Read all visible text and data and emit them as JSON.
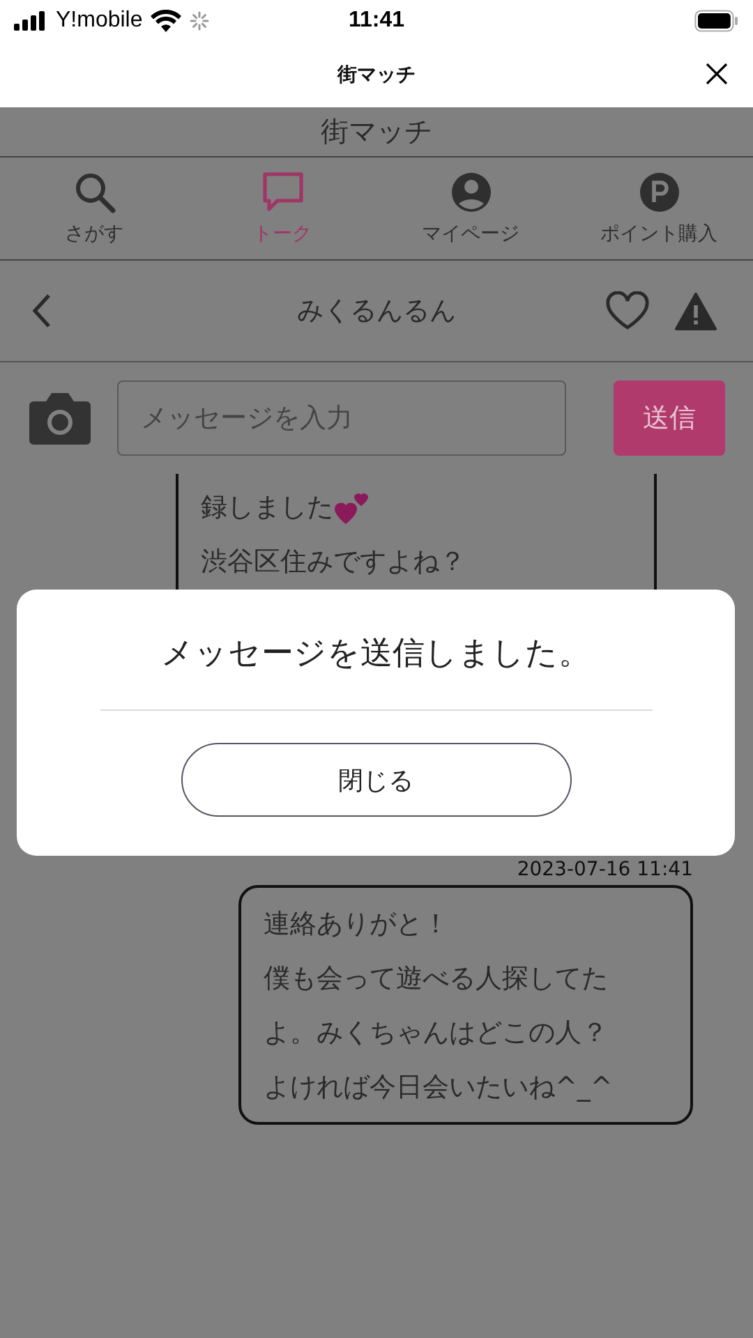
{
  "status_bar": {
    "carrier": "Y!mobile",
    "time": "11:41"
  },
  "browser": {
    "title": "街マッチ"
  },
  "app": {
    "title": "街マッチ"
  },
  "tabs": [
    {
      "kind": "search",
      "label": "さがす",
      "selected": false
    },
    {
      "kind": "talk",
      "label": "トーク",
      "selected": true
    },
    {
      "kind": "mypage",
      "label": "マイページ",
      "selected": false
    },
    {
      "kind": "points",
      "label": "ポイント購入",
      "selected": false
    }
  ],
  "chat": {
    "partner": "みくるんるん"
  },
  "composer": {
    "placeholder": "メッセージを入力",
    "send": "送信"
  },
  "messages": [
    {
      "kind": "received",
      "lines": [
        {
          "kind": "hearts",
          "text": "録しました"
        },
        {
          "kind": "plain",
          "text": "渋谷区住みですよね？"
        }
      ]
    },
    {
      "kind": "sent",
      "time": "2023-07-16 11:41",
      "lines": [
        {
          "kind": "plain",
          "text": "連絡ありがと！"
        },
        {
          "kind": "plain",
          "text": "僕も会って遊べる人探してた"
        },
        {
          "kind": "plain",
          "text": "よ。みくちゃんはどこの人？"
        },
        {
          "kind": "plain",
          "text": "よければ今日会いたいね^_^"
        }
      ]
    }
  ],
  "dialog": {
    "message": "メッセージを送信しました。",
    "button": "閉じる"
  }
}
